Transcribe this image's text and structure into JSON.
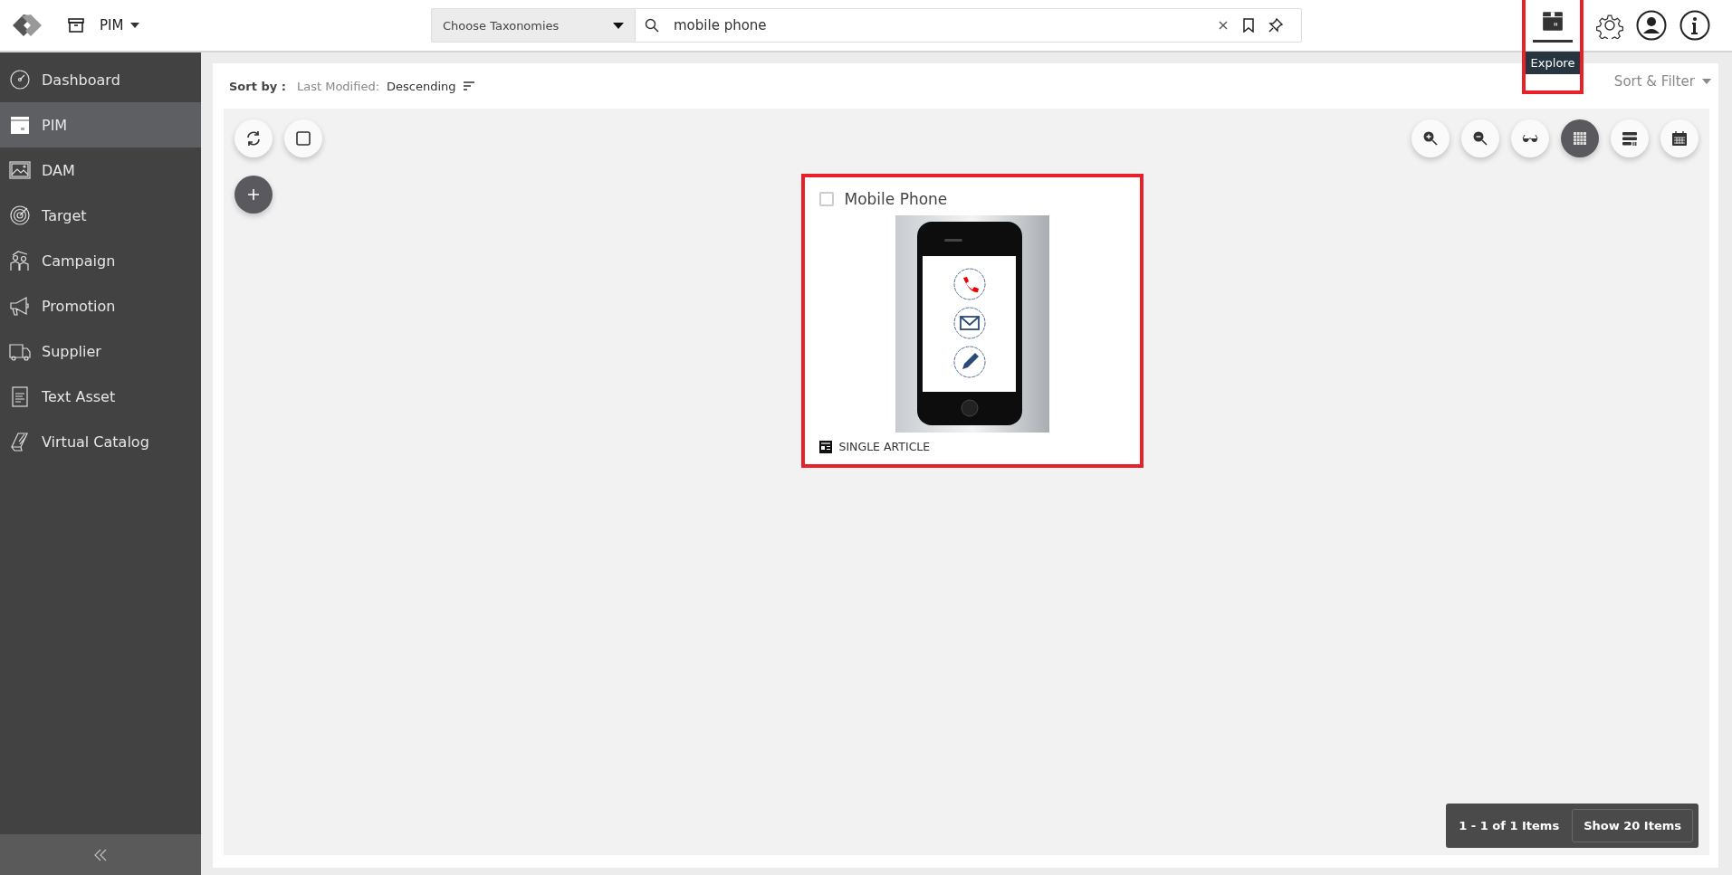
{
  "header": {
    "module": "PIM",
    "taxonomy_placeholder": "Choose Taxonomies",
    "search": {
      "value": "mobile phone"
    },
    "explore": {
      "tooltip": "Explore",
      "highlighted": true
    }
  },
  "sidebar": {
    "items": [
      {
        "label": "Dashboard",
        "selected": false
      },
      {
        "label": "PIM",
        "selected": true
      },
      {
        "label": "DAM",
        "selected": false
      },
      {
        "label": "Target",
        "selected": false
      },
      {
        "label": "Campaign",
        "selected": false
      },
      {
        "label": "Promotion",
        "selected": false
      },
      {
        "label": "Supplier",
        "selected": false
      },
      {
        "label": "Text Asset",
        "selected": false
      },
      {
        "label": "Virtual Catalog",
        "selected": false
      }
    ]
  },
  "sort": {
    "label": "Sort by :",
    "field": "Last Modified:",
    "order": "Descending",
    "filter": "Sort & Filter"
  },
  "view_buttons": [
    {
      "selected": false
    },
    {
      "selected": false
    },
    {
      "selected": false
    },
    {
      "selected": true
    },
    {
      "selected": false
    },
    {
      "selected": false
    }
  ],
  "cards": [
    {
      "title": "Mobile Phone",
      "checked": false,
      "type": "SINGLE ARTICLE",
      "highlighted": true
    }
  ],
  "pagination": {
    "range": "1 - 1 of 1 Items",
    "page_size": "Show 20 Items"
  }
}
